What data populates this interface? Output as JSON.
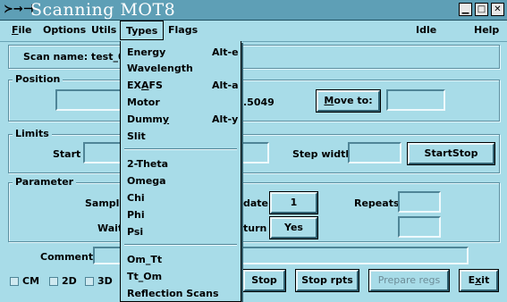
{
  "window": {
    "title": "Scanning MOT8",
    "sys_icon": "≻→⊣",
    "controls": [
      "▁",
      "□",
      "✕"
    ]
  },
  "menubar": {
    "file": "File",
    "options": "Options",
    "utils": "Utils",
    "types": "Types",
    "flags": "Flags",
    "status": "Idle",
    "help": "Help"
  },
  "scan_name": {
    "label": "Scan name: test_0000",
    "value": ""
  },
  "position": {
    "title": "Position",
    "value_text": ".5049",
    "move_to_label": "Move to:",
    "move_to_value": ""
  },
  "limits": {
    "title": "Limits",
    "start_label": "Start",
    "start_value": "",
    "stop_value": "",
    "step_width_label": "Step width",
    "step_width_value": "",
    "startstop_label": "StartStop"
  },
  "parameter": {
    "title": "Parameter",
    "sample_label": "Sample",
    "update_label": "date",
    "update_value": "1",
    "repeats_label": "Repeats",
    "repeats_value": "",
    "wait_label": "Wait",
    "return_label": "turn",
    "return_value": "Yes",
    "extra_value": ""
  },
  "comment": {
    "label": "Comment:",
    "value": ""
  },
  "bottom": {
    "checks": [
      "CM",
      "2D",
      "3D"
    ],
    "stop": "Stop",
    "stop_rpts": "Stop rpts",
    "prepare_regs": "Prepare regs",
    "exit": "Exit"
  },
  "types_menu": {
    "group1": [
      {
        "label": "Energy",
        "accel": "Alt-e"
      },
      {
        "label": "Wavelength",
        "accel": ""
      },
      {
        "label": "EXAFS",
        "accel": "Alt-a"
      },
      {
        "label": "Motor",
        "accel": ""
      },
      {
        "label": "Dummy",
        "accel": "Alt-y"
      },
      {
        "label": "Slit",
        "accel": ""
      }
    ],
    "group2": [
      "2-Theta",
      "Omega",
      "Chi",
      "Phi",
      "Psi"
    ],
    "group3": [
      "Om_Tt",
      "Tt_Om",
      "Reflection Scans"
    ]
  }
}
